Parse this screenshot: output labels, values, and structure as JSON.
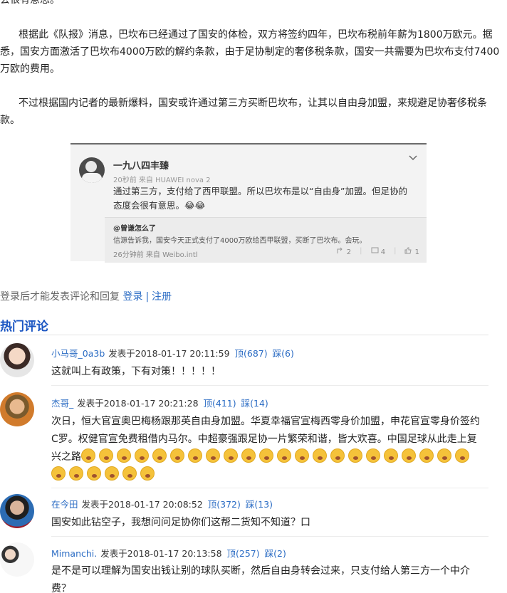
{
  "article": {
    "p0": "会很有意思。”",
    "p1": "根据此《队报》消息，巴坎布已经通过了国安的体检，双方将签约四年，巴坎布税前年薪为1800万欧元。据悉，国安方面激活了巴坎布4000万欧的解约条款，由于足协制定的奢侈税条款，国安一共需要为巴坎布支付7400万欧的费用。",
    "p2": "不过根据国内记者的最新爆料，国安或许通过第三方买断巴坎布，让其以自由身加盟，来规避足协奢侈税条款。"
  },
  "embed": {
    "name": "一九八四丰臻",
    "meta": "20秒前 来自 HUAWEI nova 2",
    "text": "通过第三方，支付给了西甲联盟。所以巴坎布是以“自由身”加盟。但足协的态度会很有意思。😂😂",
    "mention": "@曾谦怎么了",
    "reply": "信源告诉我，国安今天正式支付了4000万欧给西甲联盟，买断了巴坎布。会玩。",
    "submeta": "26分钟前 来自 Weibo.intl",
    "repost": "2",
    "comments": "4",
    "likes": "1",
    "chevron": "chevron-down-icon"
  },
  "login": {
    "prompt": "登录后才能发表评论和回复",
    "login_link": "登录",
    "separator": "|",
    "register_link": "注册"
  },
  "hot": {
    "title": "热门评论"
  },
  "comments": [
    {
      "user": "小马哥_0a3b",
      "posted": "发表于2018-01-17 20:11:59",
      "up": "顶(687)",
      "down": "踩(6)",
      "text": "这就叫上有政策，下有对策！！！！！"
    },
    {
      "user": "杰哥_",
      "posted": "发表于2018-01-17 20:21:28",
      "up": "顶(411)",
      "down": "踩(14)",
      "text": "次日，恒大官宣奥巴梅杨跟那英自由身加盟。华夏幸福官宣梅西零身价加盟，申花官宣零身价签约C罗。权健官宣免费租借内马尔。中超豪强跟足协一片繁荣和谐，皆大欢喜。中国足球从此走上复兴之路",
      "emoji_count": 28
    },
    {
      "user": "在今田",
      "posted": "发表于2018-01-17 20:08:52",
      "up": "顶(372)",
      "down": "踩(13)",
      "text": "国安如此钻空子，我想问问足协你们这帮二货知不知道？口"
    },
    {
      "user": "Mimanchi.",
      "posted": "发表于2018-01-17 20:13:58",
      "up": "顶(257)",
      "down": "踩(2)",
      "text": "是不是可以理解为国安出钱让别的球队买断，然后自由身转会过来，只支付给人第三方一个中介费？"
    }
  ]
}
